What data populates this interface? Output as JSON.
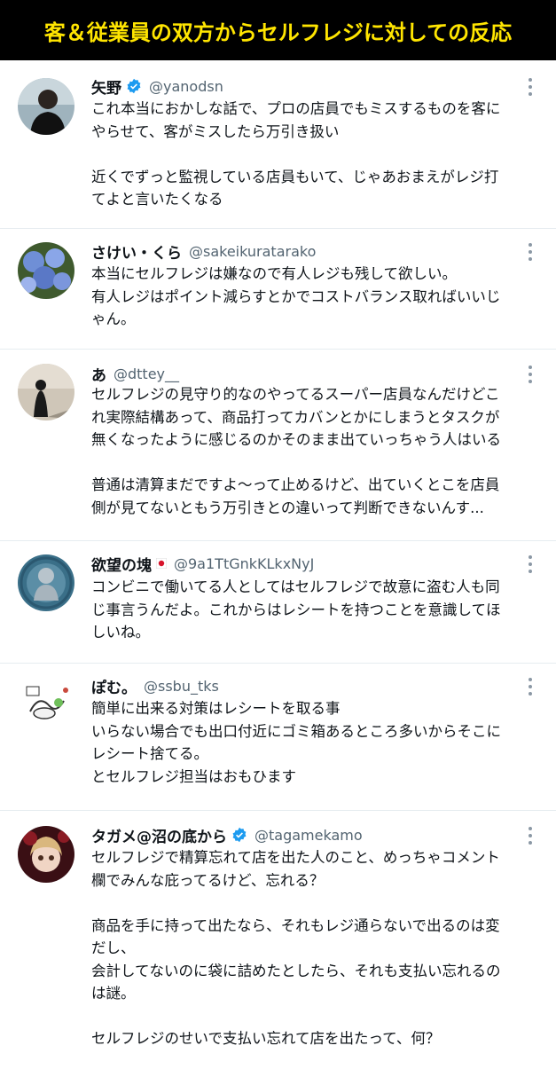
{
  "banner": {
    "title": "客＆従業員の双方からセルフレジに対しての反応"
  },
  "tweets": [
    {
      "name": "矢野",
      "verified": true,
      "handle": "@yanodsn",
      "paragraphs": [
        "これ本当におかしな話で、プロの店員でもミスするものを客に\nやらせて、客がミスしたら万引き扱い",
        "近くでずっと監視している店員もいて、じゃあおまえがレジ打\nてよと言いたくなる"
      ]
    },
    {
      "name": "さけい・くら",
      "verified": false,
      "handle": "@sakeikuratarako",
      "paragraphs": [
        "本当にセルフレジは嫌なので有人レジも残して欲しい。\n有人レジはポイント減らすとかでコストバランス取ればいいじ\nゃん。"
      ]
    },
    {
      "name": "あ",
      "verified": false,
      "handle": "@dttey__",
      "paragraphs": [
        "セルフレジの見守り的なのやってるスーパー店員なんだけどこ\nれ実際結構あって、商品打ってカバンとかにしまうとタスクが\n無くなったように感じるのかそのまま出ていっちゃう人はいる",
        "普通は清算まだですよ～って止めるけど、出ていくとこを店員\n側が見てないともう万引きとの違いって判断できないんす..."
      ]
    },
    {
      "name": "欲望の塊",
      "verified": false,
      "flag": "japan-flag-icon",
      "handle": "@9a1TtGnkKLkxNyJ",
      "paragraphs": [
        "コンビニで働いてる人としてはセルフレジで故意に盗む人も同\nじ事言うんだよ。これからはレシートを持つことを意識してほ\nしいね。"
      ]
    },
    {
      "name": "ぽむ。",
      "verified": false,
      "handle": "@ssbu_tks",
      "paragraphs": [
        "簡単に出来る対策はレシートを取る事\nいらない場合でも出口付近にゴミ箱あるところ多いからそこに\nレシート捨てる。\nとセルフレジ担当はおもひます"
      ]
    },
    {
      "name": "タガメ@沼の底から",
      "verified": true,
      "handle": "@tagamekamo",
      "paragraphs": [
        "セルフレジで精算忘れて店を出た人のこと、めっちゃコメント\n欄でみんな庇ってるけど、忘れる？",
        "商品を手に持って出たなら、それもレジ通らないで出るのは変\nだし、\n会計してないのに袋に詰めたとしたら、それも支払い忘れるの\nは謎。",
        "セルフレジのせいで支払い忘れて店を出たって、何？"
      ]
    }
  ],
  "colors": {
    "banner_bg": "#000000",
    "banner_text": "#ffe500",
    "handle": "#536471",
    "verified": "#1d9bf0"
  },
  "icons": {
    "verified": "verified-badge-icon",
    "more": "more-options-icon"
  }
}
